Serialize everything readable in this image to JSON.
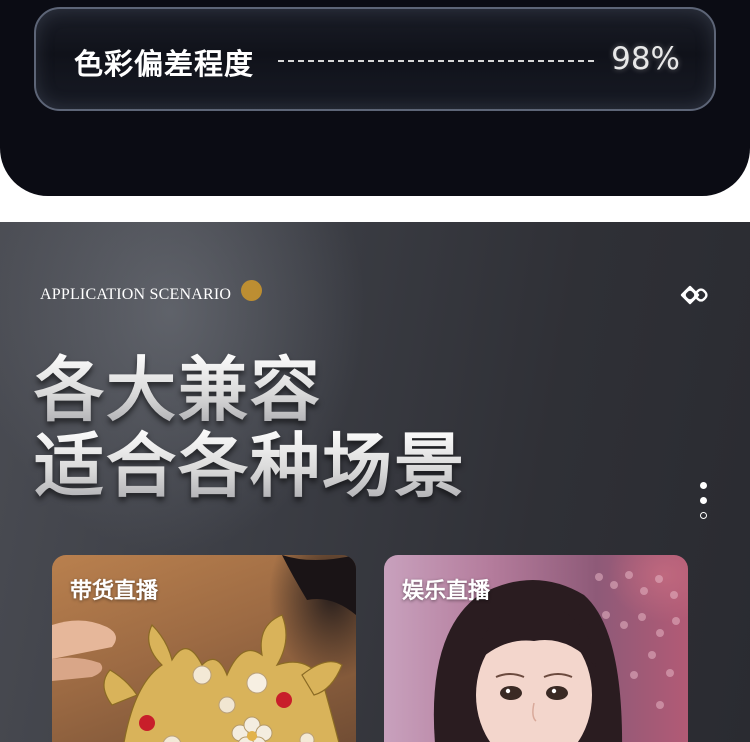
{
  "metric": {
    "label": "色彩偏差程度",
    "value": "98%"
  },
  "application": {
    "eyebrow": "APPLICATION SCENARIO",
    "headline_line1": "各大兼容",
    "headline_line2": "适合各种场景",
    "pager": {
      "pages": 3,
      "active_indexes": [
        0,
        1
      ]
    },
    "cards": [
      {
        "label": "带货直播",
        "image": "hair-ornament-photo"
      },
      {
        "label": "娱乐直播",
        "image": "female-streamer-photo"
      }
    ]
  },
  "colors": {
    "top_background": "#0b0c14",
    "accent_gold": "#c9952e",
    "card_border": "#5d6577"
  },
  "icons": [
    "interlocking-rings-icon",
    "gold-dot-icon",
    "pager-dots-icon"
  ]
}
